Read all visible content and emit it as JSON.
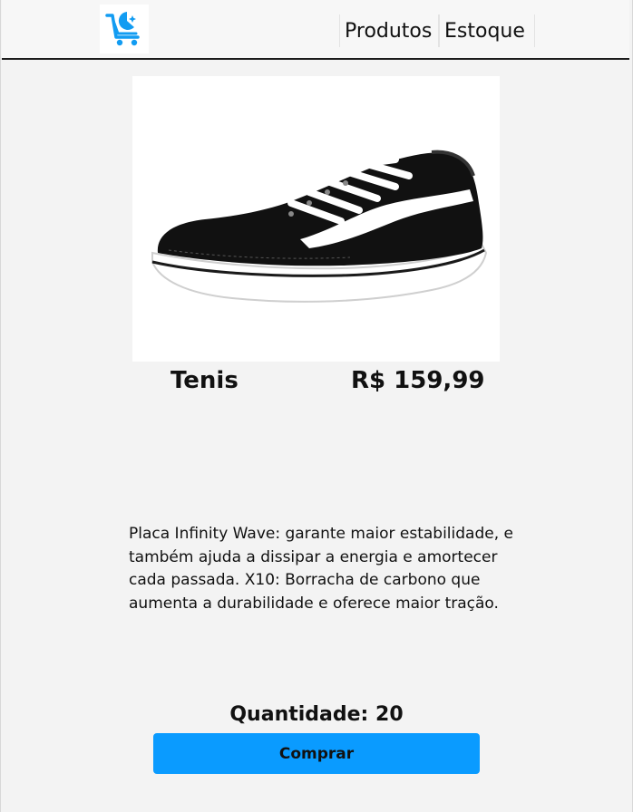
{
  "header": {
    "logo_icon": "shopping-cart-logo-icon",
    "nav": [
      {
        "label": "Produtos"
      },
      {
        "label": "Estoque"
      }
    ],
    "accent_color": "#0a9bff"
  },
  "product": {
    "image_icon": "sneaker-image",
    "name": "Tenis",
    "price": "R$ 159,99",
    "description": "Placa Infinity Wave: garante maior estabilidade, e também ajuda a dissipar a energia e amortecer cada passada. X10: Borracha de carbono que aumenta a durabilidade e oferece maior tração.",
    "quantity_text": "Quantidade: 20",
    "buy_label": "Comprar",
    "button_color": "#0a9bff"
  }
}
